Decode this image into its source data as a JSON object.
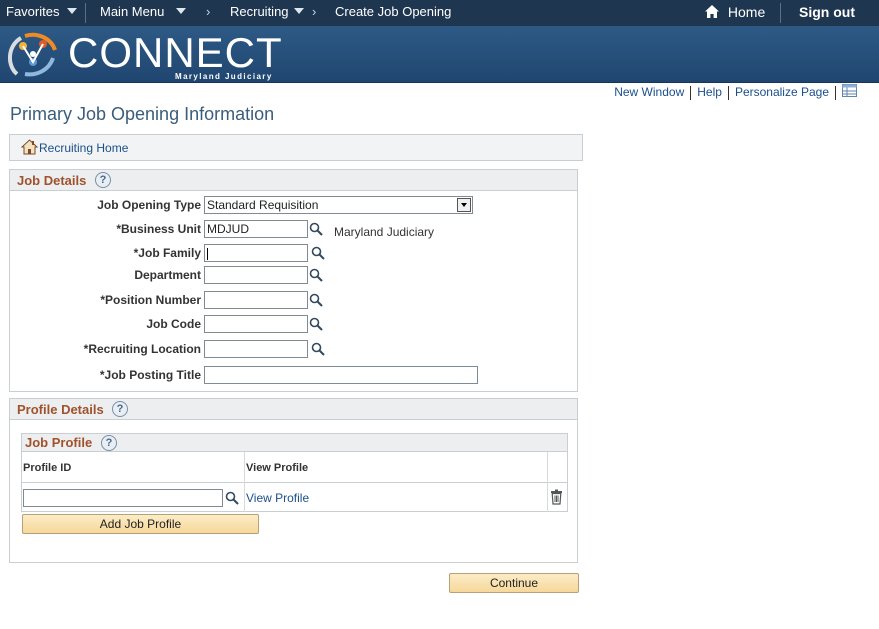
{
  "topnav": {
    "favorites": "Favorites",
    "main_menu": "Main Menu",
    "recruiting": "Recruiting",
    "create_job_opening": "Create Job Opening",
    "home": "Home",
    "sign_out": "Sign out"
  },
  "banner": {
    "brand": "CONNECT",
    "subtitle": "Maryland Judiciary"
  },
  "util_links": {
    "new_window": "New Window",
    "help": "Help",
    "personalize_page": "Personalize Page"
  },
  "page_title": "Primary Job Opening Information",
  "recruiting_home": "Recruiting Home",
  "job_details": {
    "title": "Job Details",
    "help_mark": "?",
    "fields": {
      "job_opening_type": {
        "label": "Job Opening Type",
        "value": "Standard Requisition"
      },
      "business_unit": {
        "label": "*Business Unit",
        "value": "MDJUD",
        "description": "Maryland Judiciary"
      },
      "job_family": {
        "label": "*Job Family",
        "value": ""
      },
      "department": {
        "label": "Department",
        "value": ""
      },
      "position_number": {
        "label": "*Position Number",
        "value": ""
      },
      "job_code": {
        "label": "Job Code",
        "value": ""
      },
      "recruiting_location": {
        "label": "*Recruiting Location",
        "value": ""
      },
      "job_posting_title": {
        "label": "*Job Posting Title",
        "value": ""
      }
    }
  },
  "profile_details": {
    "title": "Profile Details",
    "help_mark": "?",
    "job_profile": {
      "title": "Job Profile",
      "help_mark": "?",
      "columns": [
        "Profile ID",
        "View Profile"
      ],
      "rows": [
        {
          "profile_id": "",
          "view_profile": "View Profile"
        }
      ],
      "add_button": "Add Job Profile"
    }
  },
  "continue_button": "Continue",
  "colors": {
    "nav_bg": "#1f3650",
    "banner_bg": "#2e5a86",
    "section_title": "#a0522d",
    "link": "#1b4f8a",
    "button_bg": "#f6d89a"
  }
}
